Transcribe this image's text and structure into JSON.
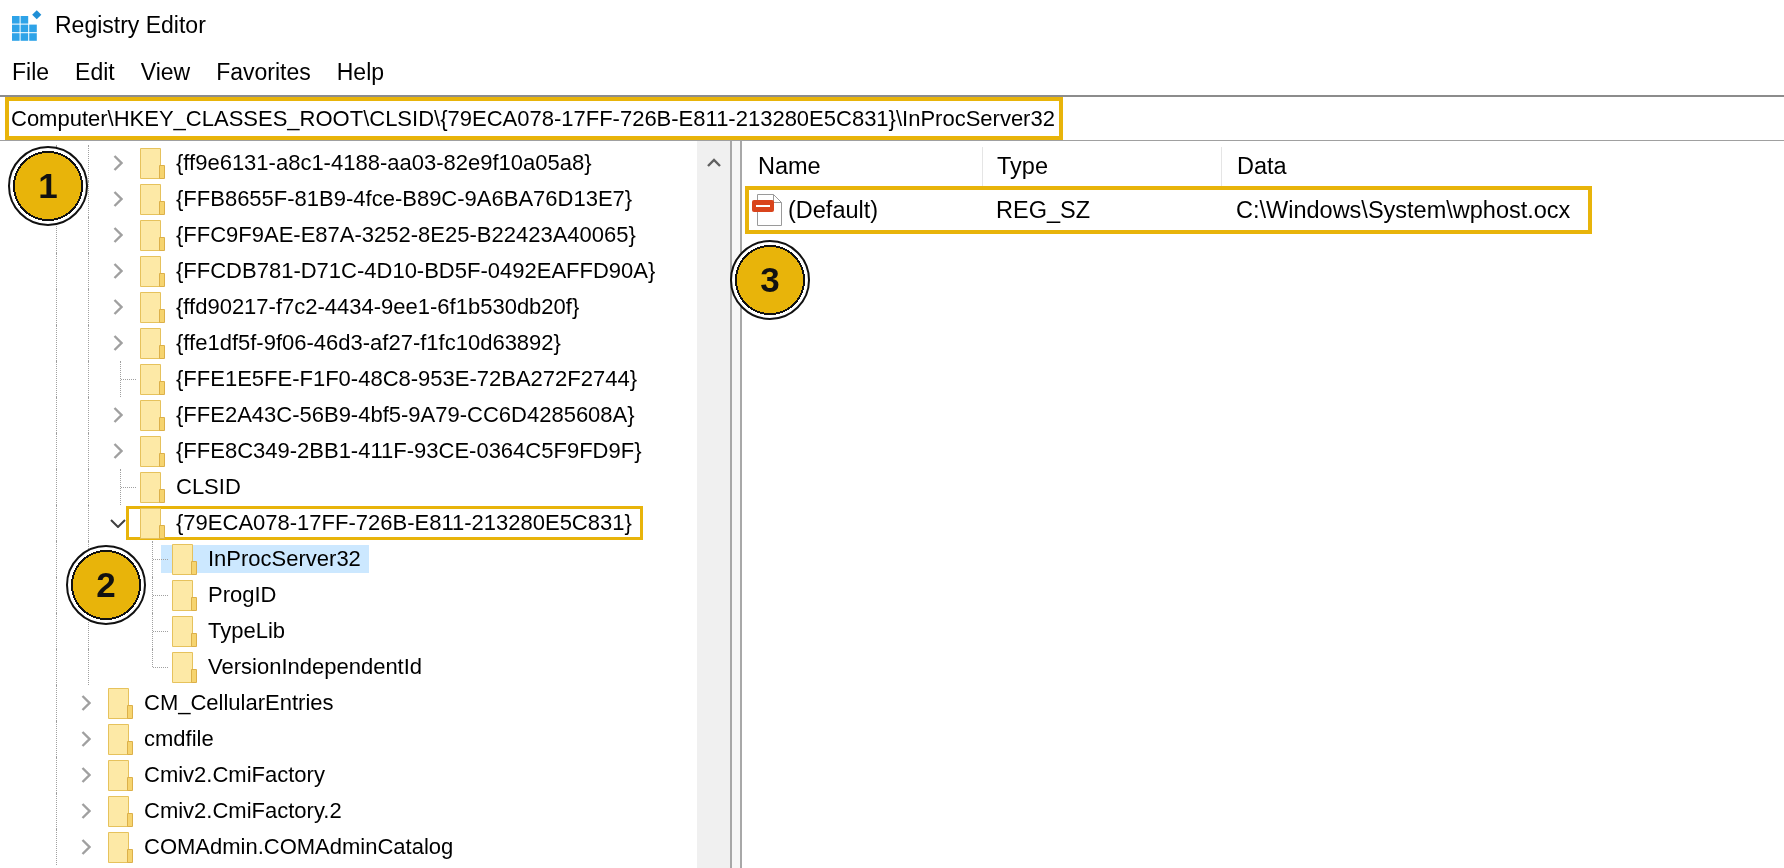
{
  "window": {
    "title": "Registry Editor"
  },
  "menu": [
    "File",
    "Edit",
    "View",
    "Favorites",
    "Help"
  ],
  "address_bar": {
    "value": "Computer\\HKEY_CLASSES_ROOT\\CLSID\\{79ECA078-17FF-726B-E811-213280E5C831}\\InProcServer32",
    "highlighted": true,
    "callout": "1"
  },
  "tree": {
    "clsid_subkeys": [
      {
        "label": "{ff9e6131-a8c1-4188-aa03-82e9f10a05a8}",
        "kind": "branch",
        "expanded": false,
        "selected": false,
        "highlighted": false
      },
      {
        "label": "{FFB8655F-81B9-4fce-B89C-9A6BA76D13E7}",
        "kind": "branch",
        "expanded": false,
        "selected": false,
        "highlighted": false
      },
      {
        "label": "{FFC9F9AE-E87A-3252-8E25-B22423A40065}",
        "kind": "branch",
        "expanded": false,
        "selected": false,
        "highlighted": false
      },
      {
        "label": "{FFCDB781-D71C-4D10-BD5F-0492EAFFD90A}",
        "kind": "branch",
        "expanded": false,
        "selected": false,
        "highlighted": false
      },
      {
        "label": "{ffd90217-f7c2-4434-9ee1-6f1b530db20f}",
        "kind": "branch",
        "expanded": false,
        "selected": false,
        "highlighted": false
      },
      {
        "label": "{ffe1df5f-9f06-46d3-af27-f1fc10d63892}",
        "kind": "branch",
        "expanded": false,
        "selected": false,
        "highlighted": false
      },
      {
        "label": "{FFE1E5FE-F1F0-48C8-953E-72BA272F2744}",
        "kind": "leaf",
        "expanded": false,
        "selected": false,
        "highlighted": false
      },
      {
        "label": "{FFE2A43C-56B9-4bf5-9A79-CC6D4285608A}",
        "kind": "branch",
        "expanded": false,
        "selected": false,
        "highlighted": false
      },
      {
        "label": "{FFE8C349-2BB1-411F-93CE-0364C5F9FD9F}",
        "kind": "branch",
        "expanded": false,
        "selected": false,
        "highlighted": false
      },
      {
        "label": "CLSID",
        "kind": "leaf",
        "expanded": false,
        "selected": false,
        "highlighted": false
      },
      {
        "label": "{79ECA078-17FF-726B-E811-213280E5C831}",
        "kind": "branch",
        "expanded": true,
        "selected": false,
        "highlighted": true,
        "callout": "2",
        "children": [
          {
            "label": "InProcServer32",
            "kind": "leaf",
            "expanded": false,
            "selected": true,
            "highlighted": false
          },
          {
            "label": "ProgID",
            "kind": "leaf",
            "expanded": false,
            "selected": false,
            "highlighted": false
          },
          {
            "label": "TypeLib",
            "kind": "leaf",
            "expanded": false,
            "selected": false,
            "highlighted": false
          },
          {
            "label": "VersionIndependentId",
            "kind": "leaf",
            "expanded": false,
            "selected": false,
            "highlighted": false
          }
        ]
      }
    ],
    "classes_root_subkeys": [
      {
        "label": "CM_CellularEntries",
        "kind": "branch",
        "expanded": false,
        "selected": false,
        "highlighted": false
      },
      {
        "label": "cmdfile",
        "kind": "branch",
        "expanded": false,
        "selected": false,
        "highlighted": false
      },
      {
        "label": "Cmiv2.CmiFactory",
        "kind": "branch",
        "expanded": false,
        "selected": false,
        "highlighted": false
      },
      {
        "label": "Cmiv2.CmiFactory.2",
        "kind": "branch",
        "expanded": false,
        "selected": false,
        "highlighted": false
      },
      {
        "label": "COMAdmin.COMAdminCatalog",
        "kind": "branch",
        "expanded": false,
        "selected": false,
        "highlighted": false
      }
    ]
  },
  "values": {
    "columns": [
      "Name",
      "Type",
      "Data"
    ],
    "rows": [
      {
        "name": "(Default)",
        "type": "REG_SZ",
        "data": "C:\\Windows\\System\\wphost.ocx",
        "highlighted": true,
        "callout": "3"
      }
    ]
  }
}
